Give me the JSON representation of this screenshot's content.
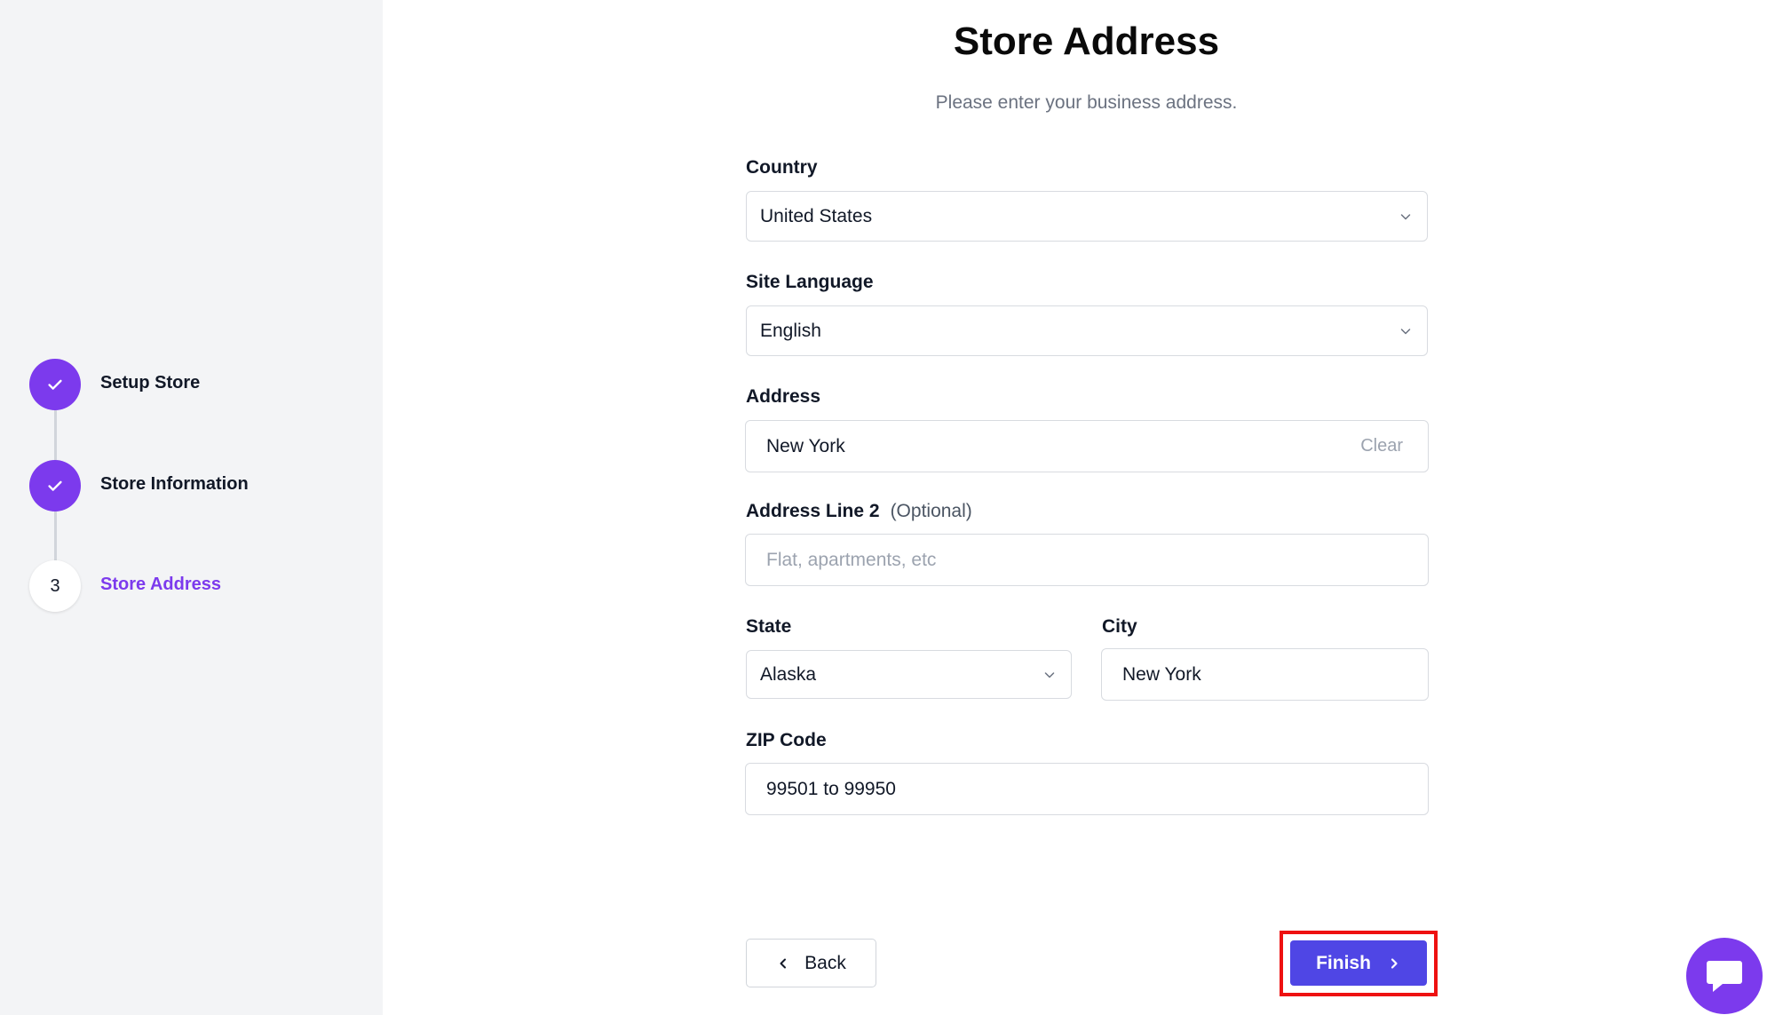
{
  "steps": [
    {
      "label": "Setup Store",
      "status": "completed",
      "icon": "check-icon"
    },
    {
      "label": "Store Information",
      "status": "completed",
      "icon": "check-icon"
    },
    {
      "label": "Store Address",
      "status": "current",
      "number": "3"
    }
  ],
  "header": {
    "title": "Store Address",
    "subtitle": "Please enter your business address."
  },
  "form": {
    "country": {
      "label": "Country",
      "value": "United States"
    },
    "site_language": {
      "label": "Site Language",
      "value": "English"
    },
    "address": {
      "label": "Address",
      "value": "New York",
      "clear_label": "Clear"
    },
    "address_line_2": {
      "label": "Address Line 2",
      "optional_label": "(Optional)",
      "placeholder": "Flat, apartments, etc"
    },
    "state": {
      "label": "State",
      "value": "Alaska"
    },
    "city": {
      "label": "City",
      "value": "New York"
    },
    "zip": {
      "label": "ZIP Code",
      "value": "99501 to 99950"
    }
  },
  "buttons": {
    "back": "Back",
    "finish": "Finish"
  },
  "icons": {
    "step_done": "check-icon",
    "select": "chevron-down-icon",
    "back": "chevron-left-icon",
    "finish": "chevron-right-icon",
    "chat": "chat-icon"
  },
  "colors": {
    "accent": "#7c3aed",
    "primary_button": "#4f46e5",
    "highlight": "#ee1111",
    "sidebar_bg": "#f3f4f6"
  }
}
